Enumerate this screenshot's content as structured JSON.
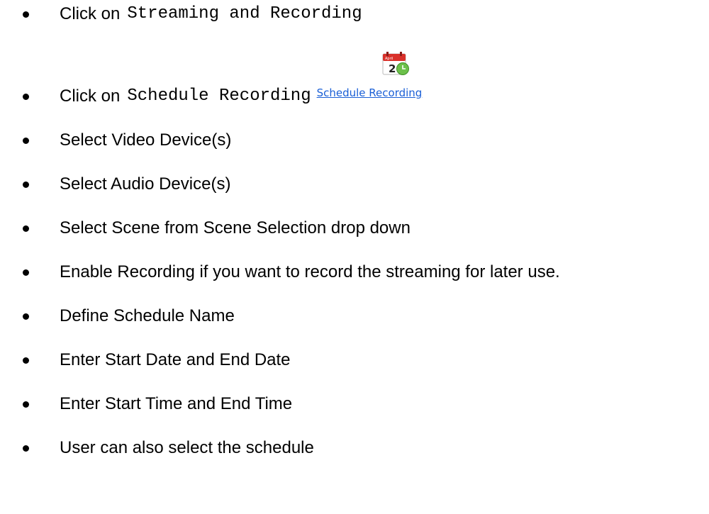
{
  "steps": [
    {
      "prefix": "Click on",
      "code": "Streaming and Recording"
    },
    {
      "prefix": "Click on",
      "code": "Schedule Recording",
      "link_label": "Schedule Recording",
      "calendar_day": "2",
      "calendar_month": "April"
    },
    {
      "text": "Select Video Device(s)"
    },
    {
      "text": "Select Audio Device(s)"
    },
    {
      "text": "Select Scene from Scene Selection drop down"
    },
    {
      "text": "Enable Recording if you want to record the streaming for later use."
    },
    {
      "text": "Define Schedule Name"
    },
    {
      "text": "Enter Start Date and End Date"
    },
    {
      "text": "Enter Start Time and End Time"
    },
    {
      "text": "User can also select the schedule"
    }
  ],
  "colors": {
    "link": "#1a5fd6",
    "calendar_red": "#d9302a",
    "calendar_green": "#6cc04a"
  },
  "icons": {
    "calendar": "calendar-schedule-icon"
  }
}
